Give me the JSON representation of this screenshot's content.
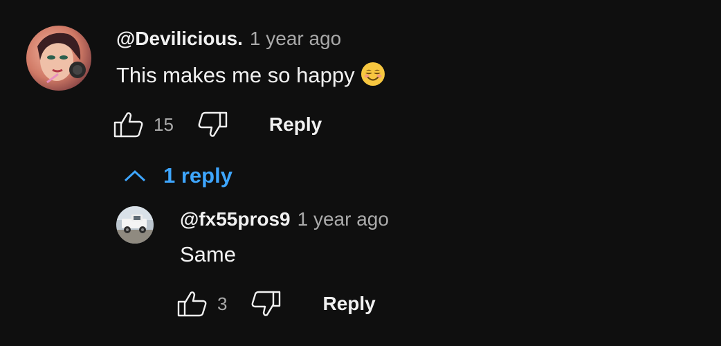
{
  "comment": {
    "author": "@Devilicious.",
    "time": "1 year ago",
    "text": "This makes me so happy",
    "emoji": "smiling-face-emoji",
    "likes": "15",
    "reply_label": "Reply",
    "replies_toggle": "1 reply",
    "avatar_icon": "profile-photo-avatar"
  },
  "reply": {
    "author": "@fx55pros9",
    "time": "1 year ago",
    "text": "Same",
    "likes": "3",
    "reply_label": "Reply",
    "avatar_icon": "white-truck-avatar"
  },
  "colors": {
    "background": "#0f0f0f",
    "text": "#f1f1f1",
    "secondary_text": "#aaaaaa",
    "link": "#3ea6ff"
  }
}
